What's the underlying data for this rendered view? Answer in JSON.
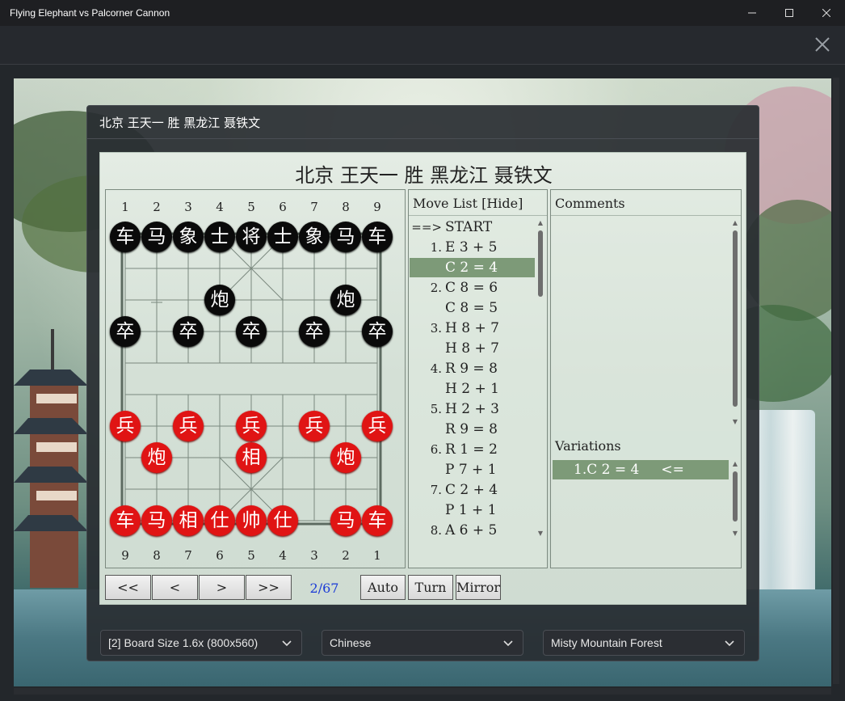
{
  "window": {
    "title": "Flying Elephant vs Palcorner Cannon",
    "minimize_icon": "minimize-icon",
    "maximize_icon": "maximize-icon",
    "close_icon": "close-icon"
  },
  "dialog": {
    "title": "北京 王天一 胜 黑龙江 聂铁文"
  },
  "game": {
    "title": "北京 王天一 胜 黑龙江 聂铁文",
    "top_columns": [
      "1",
      "2",
      "3",
      "4",
      "5",
      "6",
      "7",
      "8",
      "9"
    ],
    "bottom_columns": [
      "9",
      "8",
      "7",
      "6",
      "5",
      "4",
      "3",
      "2",
      "1"
    ],
    "pieces": [
      {
        "ch": "车",
        "side": "black",
        "file": 1,
        "rank": 1
      },
      {
        "ch": "马",
        "side": "black",
        "file": 2,
        "rank": 1
      },
      {
        "ch": "象",
        "side": "black",
        "file": 3,
        "rank": 1
      },
      {
        "ch": "士",
        "side": "black",
        "file": 4,
        "rank": 1
      },
      {
        "ch": "将",
        "side": "black",
        "file": 5,
        "rank": 1
      },
      {
        "ch": "士",
        "side": "black",
        "file": 6,
        "rank": 1
      },
      {
        "ch": "象",
        "side": "black",
        "file": 7,
        "rank": 1
      },
      {
        "ch": "马",
        "side": "black",
        "file": 8,
        "rank": 1
      },
      {
        "ch": "车",
        "side": "black",
        "file": 9,
        "rank": 1
      },
      {
        "ch": "炮",
        "side": "black",
        "file": 4,
        "rank": 3
      },
      {
        "ch": "炮",
        "side": "black",
        "file": 8,
        "rank": 3
      },
      {
        "ch": "卒",
        "side": "black",
        "file": 1,
        "rank": 4
      },
      {
        "ch": "卒",
        "side": "black",
        "file": 3,
        "rank": 4
      },
      {
        "ch": "卒",
        "side": "black",
        "file": 5,
        "rank": 4
      },
      {
        "ch": "卒",
        "side": "black",
        "file": 7,
        "rank": 4
      },
      {
        "ch": "卒",
        "side": "black",
        "file": 9,
        "rank": 4
      },
      {
        "ch": "兵",
        "side": "red",
        "file": 1,
        "rank": 7
      },
      {
        "ch": "兵",
        "side": "red",
        "file": 3,
        "rank": 7
      },
      {
        "ch": "兵",
        "side": "red",
        "file": 5,
        "rank": 7
      },
      {
        "ch": "兵",
        "side": "red",
        "file": 7,
        "rank": 7
      },
      {
        "ch": "兵",
        "side": "red",
        "file": 9,
        "rank": 7
      },
      {
        "ch": "炮",
        "side": "red",
        "file": 2,
        "rank": 8
      },
      {
        "ch": "相",
        "side": "red",
        "file": 5,
        "rank": 8
      },
      {
        "ch": "炮",
        "side": "red",
        "file": 8,
        "rank": 8
      },
      {
        "ch": "车",
        "side": "red",
        "file": 1,
        "rank": 10
      },
      {
        "ch": "马",
        "side": "red",
        "file": 2,
        "rank": 10
      },
      {
        "ch": "相",
        "side": "red",
        "file": 3,
        "rank": 10
      },
      {
        "ch": "仕",
        "side": "red",
        "file": 4,
        "rank": 10
      },
      {
        "ch": "帅",
        "side": "red",
        "file": 5,
        "rank": 10
      },
      {
        "ch": "仕",
        "side": "red",
        "file": 6,
        "rank": 10
      },
      {
        "ch": "马",
        "side": "red",
        "file": 8,
        "rank": 10
      },
      {
        "ch": "车",
        "side": "red",
        "file": 9,
        "rank": 10
      }
    ]
  },
  "move_list": {
    "header": "Move List [Hide]",
    "moves": [
      {
        "num": "==>",
        "text": "START",
        "selected": false
      },
      {
        "num": "1.",
        "text": "E 3 + 5",
        "selected": false
      },
      {
        "num": "",
        "text": "C 2 = 4",
        "selected": true
      },
      {
        "num": "2.",
        "text": "C 8 = 6",
        "selected": false
      },
      {
        "num": "",
        "text": "C 8 = 5",
        "selected": false
      },
      {
        "num": "3.",
        "text": "H 8 + 7",
        "selected": false
      },
      {
        "num": "",
        "text": "H 8 + 7",
        "selected": false
      },
      {
        "num": "4.",
        "text": "R 9 = 8",
        "selected": false
      },
      {
        "num": "",
        "text": "H 2 + 1",
        "selected": false
      },
      {
        "num": "5.",
        "text": "H 2 + 3",
        "selected": false
      },
      {
        "num": "",
        "text": "R 9 = 8",
        "selected": false
      },
      {
        "num": "6.",
        "text": "R 1 = 2",
        "selected": false
      },
      {
        "num": "",
        "text": "P 7 + 1",
        "selected": false
      },
      {
        "num": "7.",
        "text": "C 2 + 4",
        "selected": false
      },
      {
        "num": "",
        "text": "P 1 + 1",
        "selected": false
      },
      {
        "num": "8.",
        "text": "A 6 + 5",
        "selected": false
      }
    ]
  },
  "comments": {
    "header": "Comments"
  },
  "variations": {
    "header": "Variations",
    "items": [
      {
        "text": "1.C 2 = 4     <="
      }
    ]
  },
  "nav": {
    "first": "<<",
    "prev": "<",
    "next": ">",
    "last": ">>",
    "counter": "2/67",
    "auto": "Auto",
    "turn": "Turn",
    "mirror": "Mirror"
  },
  "dropdowns": {
    "board_size": "[2] Board Size 1.6x (800x560)",
    "language": "Chinese",
    "theme": "Misty Mountain Forest"
  },
  "colors": {
    "black_piece": "#0a0a0a",
    "red_piece": "#e01414",
    "selected_move": "#7d9a78",
    "counter_text": "#1a3ad6"
  }
}
